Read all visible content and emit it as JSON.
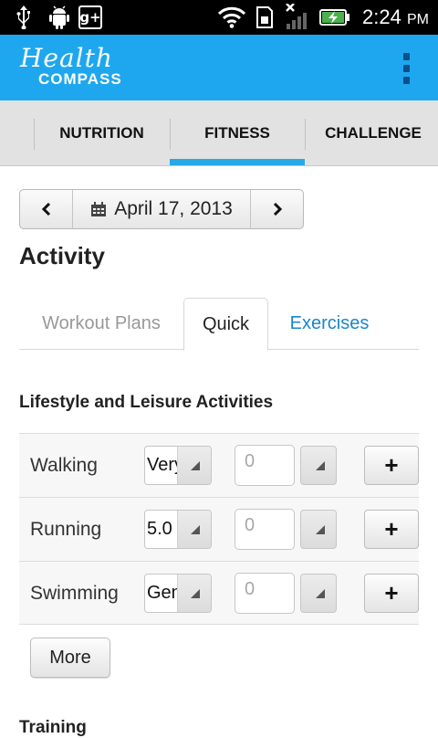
{
  "status_bar": {
    "time": "2:24",
    "ampm": "PM",
    "icons": [
      "usb-icon",
      "android-debug-icon",
      "google-plus-icon",
      "wifi-icon",
      "sd-card-icon",
      "signal-icon",
      "battery-charging-icon"
    ],
    "gplus_label": "g+"
  },
  "header": {
    "logo_line1": "Health",
    "logo_line2": "COMPASS",
    "accent_color": "#1ea7ee"
  },
  "nav": {
    "tabs": [
      {
        "label": "NUTRITION",
        "active": false
      },
      {
        "label": "FITNESS",
        "active": true
      },
      {
        "label": "CHALLENGE",
        "active": false
      }
    ]
  },
  "date_picker": {
    "prev": "◀",
    "date": "April 17, 2013",
    "next": "▶"
  },
  "activity": {
    "title": "Activity",
    "tabs": [
      {
        "label": "Workout Plans",
        "active": false
      },
      {
        "label": "Quick",
        "active": true
      },
      {
        "label": "Exercises",
        "active": false
      }
    ],
    "section_title": "Lifestyle and Leisure Activities",
    "rows": [
      {
        "name": "Walking",
        "select_value": "Very",
        "qty_placeholder": "0",
        "add": "+"
      },
      {
        "name": "Running",
        "select_value": "5.0",
        "qty_placeholder": "0",
        "add": "+"
      },
      {
        "name": "Swimming",
        "select_value": "Gen",
        "qty_placeholder": "0",
        "add": "+"
      }
    ],
    "more_label": "More",
    "next_section_title": "Training"
  }
}
